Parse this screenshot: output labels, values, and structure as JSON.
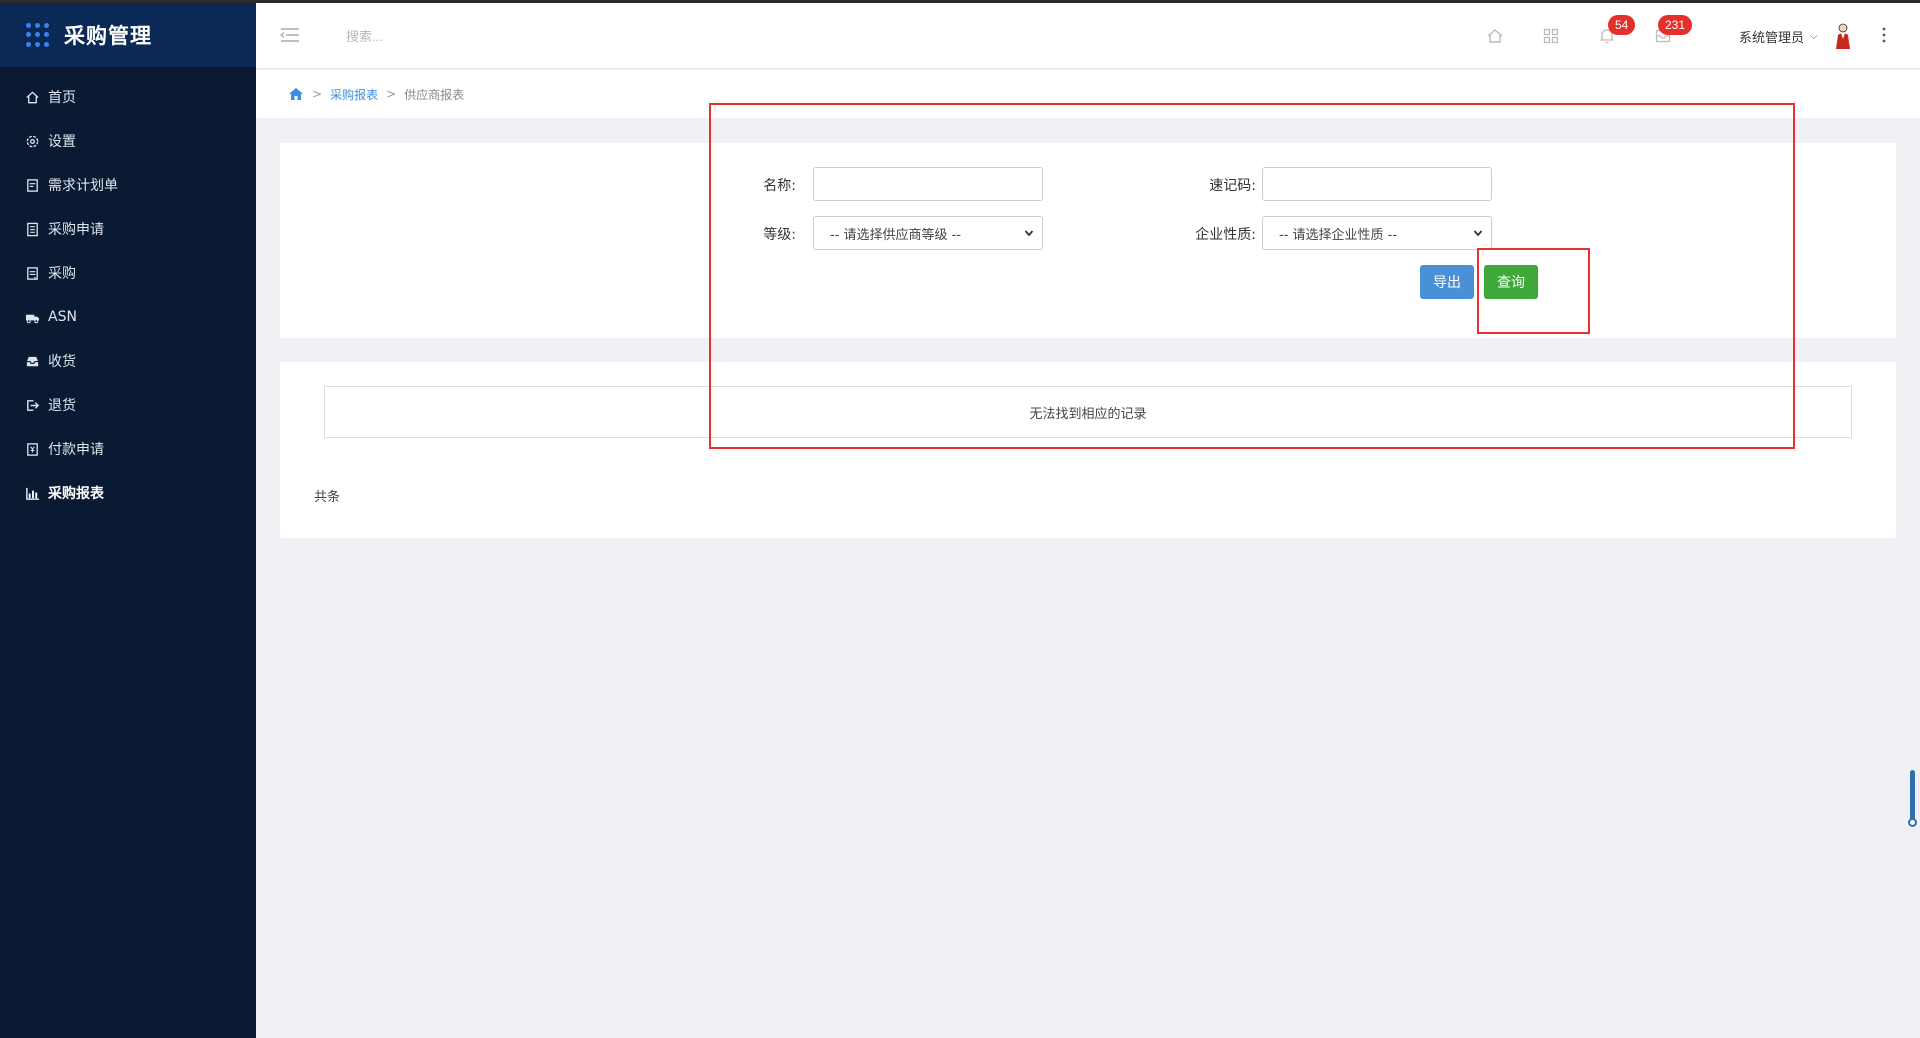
{
  "app": {
    "title": "采购管理",
    "brand_dot_colors": [
      "#3b82f6",
      "#3b82f6",
      "#3b82f6",
      "#3b82f6",
      "#3b82f6",
      "#3b82f6",
      "#3b82f6",
      "#3b82f6",
      "#3b82f6"
    ]
  },
  "sidebar": {
    "items": [
      {
        "label": "首页",
        "icon": "home-icon",
        "active": false
      },
      {
        "label": "设置",
        "icon": "gear-icon",
        "active": false
      },
      {
        "label": "需求计划单",
        "icon": "document-icon",
        "active": false
      },
      {
        "label": "采购申请",
        "icon": "list-icon",
        "active": false
      },
      {
        "label": "采购",
        "icon": "clipboard-icon",
        "active": false
      },
      {
        "label": "ASN",
        "icon": "truck-icon",
        "active": false
      },
      {
        "label": "收货",
        "icon": "inbox-icon",
        "active": false
      },
      {
        "label": "退货",
        "icon": "return-icon",
        "active": false
      },
      {
        "label": "付款申请",
        "icon": "payment-icon",
        "active": false
      },
      {
        "label": "采购报表",
        "icon": "bar-chart-icon",
        "active": true
      }
    ]
  },
  "header": {
    "search_placeholder": "搜索...",
    "notifications_count": "54",
    "messages_count": "231",
    "user_name": "系统管理员"
  },
  "breadcrumb": {
    "level1": "采购报表",
    "level2": "供应商报表",
    "separator": ">"
  },
  "filters": {
    "name_label": "名称:",
    "name_value": "",
    "code_label": "速记码:",
    "code_value": "",
    "grade_label": "等级:",
    "grade_selected": "-- 请选择供应商等级 --",
    "nature_label": "企业性质:",
    "nature_selected": "-- 请选择企业性质 --",
    "export_label": "导出",
    "query_label": "查询"
  },
  "results": {
    "empty_message": "无法找到相应的记录",
    "total_text": "共条"
  },
  "colors": {
    "sidebar_bg": "#0b1a33",
    "accent_blue": "#4a90d9",
    "accent_green": "#3fa83a",
    "badge_red": "#e4302a",
    "highlight_red": "#e83030"
  }
}
